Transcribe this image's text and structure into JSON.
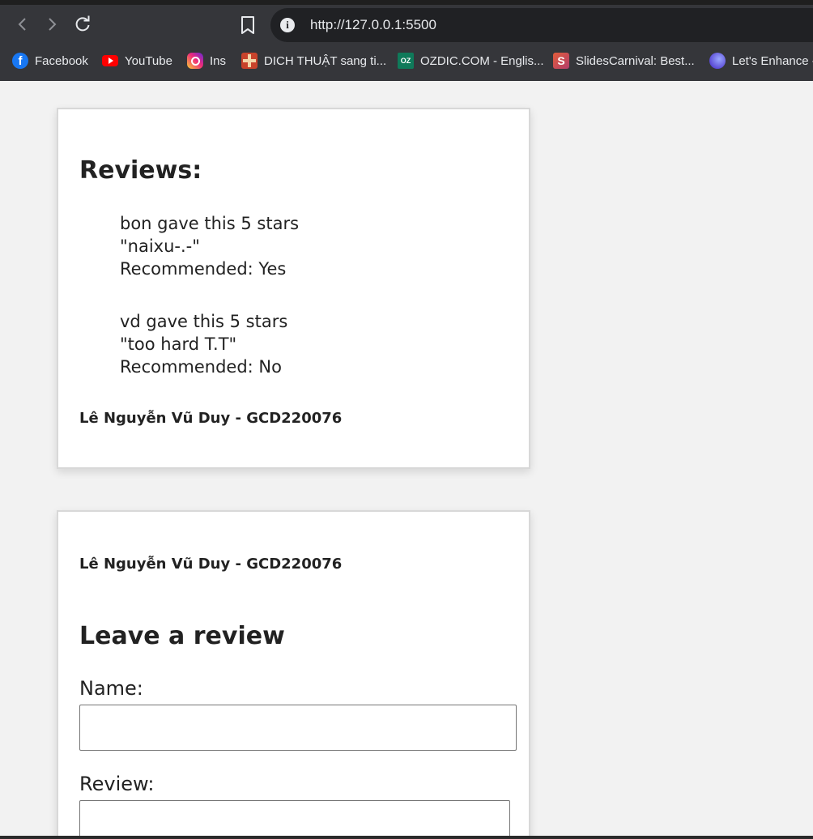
{
  "browser": {
    "url": "http://127.0.0.1:5500",
    "nav": {
      "back_icon": "chevron-left-icon",
      "forward_icon": "chevron-right-icon",
      "reload_icon": "reload-icon",
      "bookmark_icon": "bookmark-icon",
      "info_icon": "info-icon"
    },
    "bookmarks": [
      {
        "label": "Facebook",
        "icon": "facebook-icon"
      },
      {
        "label": "YouTube",
        "icon": "youtube-icon"
      },
      {
        "label": "Ins",
        "icon": "instagram-icon"
      },
      {
        "label": "DICH THUẬT sang ti...",
        "icon": "oxford-crest-icon"
      },
      {
        "label": "OZDIC.COM - Englis...",
        "icon": "ozdic-icon"
      },
      {
        "label": "SlidesCarnival: Best...",
        "icon": "slidescarnival-icon"
      },
      {
        "label": "Let's Enhance -",
        "icon": "letsenhance-icon"
      }
    ],
    "favicon_text": {
      "facebook": "f",
      "ozdic": "OZ",
      "slidescarnival": "S",
      "info": "i"
    }
  },
  "reviews_card": {
    "heading": "Reviews:",
    "reviews": [
      {
        "summary": "bon gave this 5 stars",
        "comment": "\"naixu-.-\"",
        "recommended": "Recommended: Yes"
      },
      {
        "summary": "vd gave this 5 stars",
        "comment": "\"too hard T.T\"",
        "recommended": "Recommended: No"
      }
    ],
    "author": "Lê Nguyễn Vũ Duy - GCD220076"
  },
  "form_card": {
    "author": "Lê Nguyễn Vũ Duy - GCD220076",
    "heading": "Leave a review",
    "name_label": "Name:",
    "name_value": "",
    "review_label": "Review:",
    "review_value": ""
  },
  "colors": {
    "chrome_bg": "#35363a",
    "omnibox_bg": "#202124",
    "page_bg": "#f2f2f2",
    "card_bg": "#ffffff",
    "text": "#222222"
  }
}
